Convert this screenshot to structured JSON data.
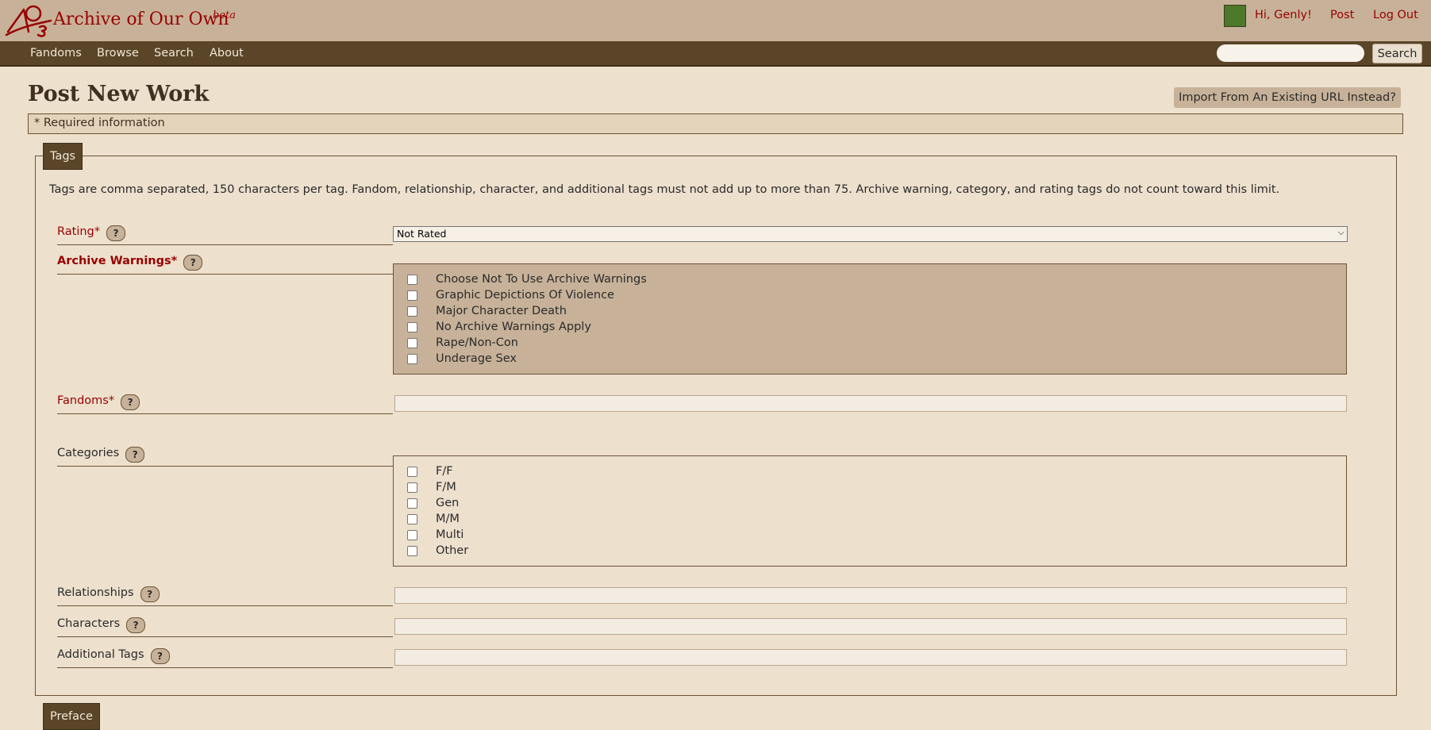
{
  "header": {
    "site_title": "Archive of Our Own",
    "beta": "beta",
    "user_greeting": "Hi, Genly!",
    "post_link": "Post",
    "logout_link": "Log Out"
  },
  "nav": {
    "items": [
      "Fandoms",
      "Browse",
      "Search",
      "About"
    ],
    "search_button": "Search",
    "search_value": ""
  },
  "page": {
    "title": "Post New Work",
    "import_button": "Import From An Existing URL Instead?",
    "required_note": "* Required information"
  },
  "tags": {
    "legend": "Tags",
    "description": "Tags are comma separated, 150 characters per tag. Fandom, relationship, character, and additional tags must not add up to more than 75. Archive warning, category, and rating tags do not count toward this limit.",
    "help_symbol": "?",
    "rating": {
      "label": "Rating*",
      "selected": "Not Rated"
    },
    "warnings": {
      "label": "Archive Warnings*",
      "options": [
        "Choose Not To Use Archive Warnings",
        "Graphic Depictions Of Violence",
        "Major Character Death",
        "No Archive Warnings Apply",
        "Rape/Non-Con",
        "Underage Sex"
      ]
    },
    "fandoms": {
      "label": "Fandoms*",
      "value": ""
    },
    "categories": {
      "label": "Categories",
      "options": [
        "F/F",
        "F/M",
        "Gen",
        "M/M",
        "Multi",
        "Other"
      ]
    },
    "relationships": {
      "label": "Relationships",
      "value": ""
    },
    "characters": {
      "label": "Characters",
      "value": ""
    },
    "additional": {
      "label": "Additional Tags",
      "value": ""
    }
  },
  "preface": {
    "legend": "Preface"
  },
  "colors": {
    "header_bg": "#c7b299",
    "nav_bg": "#5a4528",
    "page_bg": "#ede0cd",
    "accent_red": "#990000"
  }
}
